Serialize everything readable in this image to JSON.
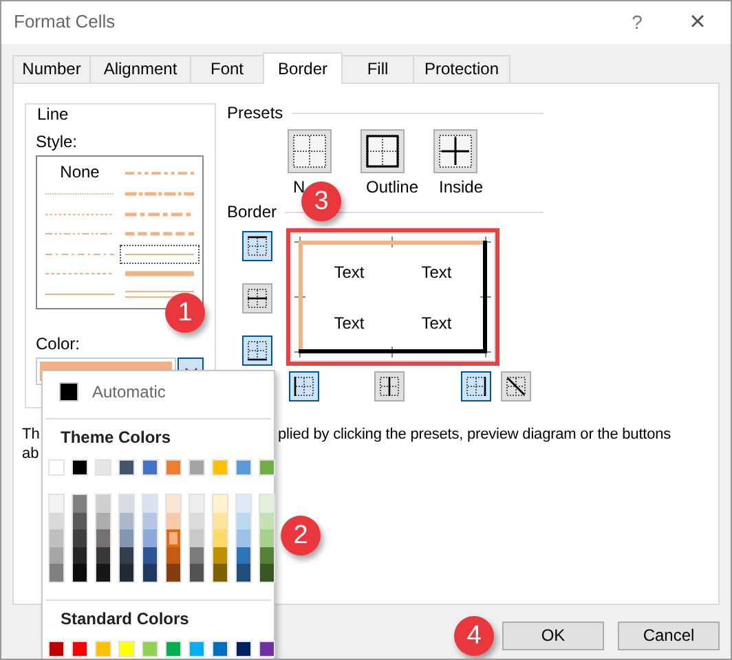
{
  "window": {
    "title": "Format Cells",
    "help": "?",
    "close": "×"
  },
  "tabs": [
    {
      "label": "Number",
      "selected": false
    },
    {
      "label": "Alignment",
      "selected": false
    },
    {
      "label": "Font",
      "selected": false
    },
    {
      "label": "Border",
      "selected": true
    },
    {
      "label": "Fill",
      "selected": false
    },
    {
      "label": "Protection",
      "selected": false
    }
  ],
  "line": {
    "heading": "Line",
    "style_label": "Style:",
    "color_label": "Color:",
    "styles": [
      {
        "kind": "none",
        "label": "None",
        "selected": false
      },
      {
        "kind": "hair",
        "selected": false
      },
      {
        "kind": "dotted",
        "selected": false
      },
      {
        "kind": "dash-dot-dot",
        "selected": false
      },
      {
        "kind": "dash-dot",
        "selected": false
      },
      {
        "kind": "dashed",
        "selected": false
      },
      {
        "kind": "thin",
        "selected": false
      },
      {
        "kind": "medium-dash-dot-dot",
        "selected": false
      },
      {
        "kind": "slanted-dash-dot",
        "selected": false
      },
      {
        "kind": "medium-dash-dot",
        "selected": false
      },
      {
        "kind": "medium-dashed",
        "selected": false
      },
      {
        "kind": "thin",
        "selected": true
      },
      {
        "kind": "thick",
        "selected": false
      },
      {
        "kind": "double",
        "selected": false
      }
    ]
  },
  "presets": {
    "heading": "Presets",
    "items": [
      {
        "kind": "none",
        "label": "N"
      },
      {
        "kind": "outline",
        "label": "Outline"
      },
      {
        "kind": "inside",
        "label": "Inside"
      }
    ]
  },
  "border": {
    "heading": "Border",
    "side_buttons": [
      {
        "kind": "top",
        "selected": true
      },
      {
        "kind": "middle-h",
        "selected": false
      },
      {
        "kind": "bottom",
        "selected": true
      }
    ],
    "bottom_buttons": [
      {
        "kind": "left",
        "selected": true
      },
      {
        "kind": "middle-v",
        "selected": false
      },
      {
        "kind": "right",
        "selected": true
      },
      {
        "kind": "diagonal",
        "selected": false
      }
    ],
    "preview": {
      "cells": [
        "Text",
        "Text",
        "Text",
        "Text"
      ],
      "edges": [
        {
          "kind": "top",
          "color": "#f4b183"
        },
        {
          "kind": "left",
          "color": "#f4b183"
        },
        {
          "kind": "right",
          "color": "#000000"
        },
        {
          "kind": "bottom",
          "color": "#000000"
        }
      ]
    }
  },
  "description": {
    "line_1_start": "Th",
    "line_1_end": "plied by clicking the presets, preview diagram or the buttons",
    "line_2_start": "ab"
  },
  "color_menu": {
    "automatic": "Automatic",
    "theme_heading": "Theme Colors",
    "standard_heading": "Standard Colors",
    "theme": [
      {
        "color": "#ffffff",
        "selected": false
      },
      {
        "color": "#000000",
        "selected": false
      },
      {
        "color": "#e7e6e6",
        "selected": false
      },
      {
        "color": "#44546a",
        "selected": false
      },
      {
        "color": "#4472c4",
        "selected": false
      },
      {
        "color": "#ed7d31",
        "selected": false
      },
      {
        "color": "#a5a5a5",
        "selected": false
      },
      {
        "color": "#ffc000",
        "selected": false
      },
      {
        "color": "#5b9bd5",
        "selected": false
      },
      {
        "color": "#70ad47",
        "selected": false
      }
    ],
    "shades": [
      [
        {
          "color": "#f2f2f2",
          "selected": false
        },
        {
          "color": "#d9d9d9",
          "selected": false
        },
        {
          "color": "#bfbfbf",
          "selected": false
        },
        {
          "color": "#a6a6a6",
          "selected": false
        },
        {
          "color": "#808080",
          "selected": false
        }
      ],
      [
        {
          "color": "#7f7f7f",
          "selected": false
        },
        {
          "color": "#595959",
          "selected": false
        },
        {
          "color": "#404040",
          "selected": false
        },
        {
          "color": "#262626",
          "selected": false
        },
        {
          "color": "#0d0d0d",
          "selected": false
        }
      ],
      [
        {
          "color": "#d0cece",
          "selected": false
        },
        {
          "color": "#aeabab",
          "selected": false
        },
        {
          "color": "#757171",
          "selected": false
        },
        {
          "color": "#3a3838",
          "selected": false
        },
        {
          "color": "#171616",
          "selected": false
        }
      ],
      [
        {
          "color": "#d6dce4",
          "selected": false
        },
        {
          "color": "#adb9ca",
          "selected": false
        },
        {
          "color": "#8497b0",
          "selected": false
        },
        {
          "color": "#333f4f",
          "selected": false
        },
        {
          "color": "#222a35",
          "selected": false
        }
      ],
      [
        {
          "color": "#d9e2f3",
          "selected": false
        },
        {
          "color": "#b4c6e7",
          "selected": false
        },
        {
          "color": "#8eaadb",
          "selected": false
        },
        {
          "color": "#2f5496",
          "selected": false
        },
        {
          "color": "#1f3864",
          "selected": false
        }
      ],
      [
        {
          "color": "#fbe5d5",
          "selected": false
        },
        {
          "color": "#f7caac",
          "selected": false
        },
        {
          "color": "#f4b183",
          "selected": true
        },
        {
          "color": "#c55a11",
          "selected": false
        },
        {
          "color": "#833c0b",
          "selected": false
        }
      ],
      [
        {
          "color": "#ededed",
          "selected": false
        },
        {
          "color": "#dbdbdb",
          "selected": false
        },
        {
          "color": "#c9c9c9",
          "selected": false
        },
        {
          "color": "#7b7b7b",
          "selected": false
        },
        {
          "color": "#525252",
          "selected": false
        }
      ],
      [
        {
          "color": "#fff2cc",
          "selected": false
        },
        {
          "color": "#fee599",
          "selected": false
        },
        {
          "color": "#ffd966",
          "selected": false
        },
        {
          "color": "#bf9000",
          "selected": false
        },
        {
          "color": "#7f6000",
          "selected": false
        }
      ],
      [
        {
          "color": "#deebf6",
          "selected": false
        },
        {
          "color": "#bdd7ee",
          "selected": false
        },
        {
          "color": "#9cc3e5",
          "selected": false
        },
        {
          "color": "#2e75b5",
          "selected": false
        },
        {
          "color": "#1e4e79",
          "selected": false
        }
      ],
      [
        {
          "color": "#e2efd9",
          "selected": false
        },
        {
          "color": "#c5e0b3",
          "selected": false
        },
        {
          "color": "#a8d08d",
          "selected": false
        },
        {
          "color": "#538135",
          "selected": false
        },
        {
          "color": "#375623",
          "selected": false
        }
      ]
    ],
    "standard": [
      {
        "color": "#c00000",
        "selected": false
      },
      {
        "color": "#ff0000",
        "selected": false
      },
      {
        "color": "#ffc000",
        "selected": false
      },
      {
        "color": "#ffff00",
        "selected": false
      },
      {
        "color": "#92d050",
        "selected": false
      },
      {
        "color": "#00b050",
        "selected": false
      },
      {
        "color": "#00b0f0",
        "selected": false
      },
      {
        "color": "#0070c0",
        "selected": false
      },
      {
        "color": "#002060",
        "selected": false
      },
      {
        "color": "#7030a0",
        "selected": false
      }
    ]
  },
  "callouts": [
    "1",
    "2",
    "3",
    "4"
  ],
  "buttons": [
    {
      "label": "OK"
    },
    {
      "label": "Cancel"
    }
  ]
}
